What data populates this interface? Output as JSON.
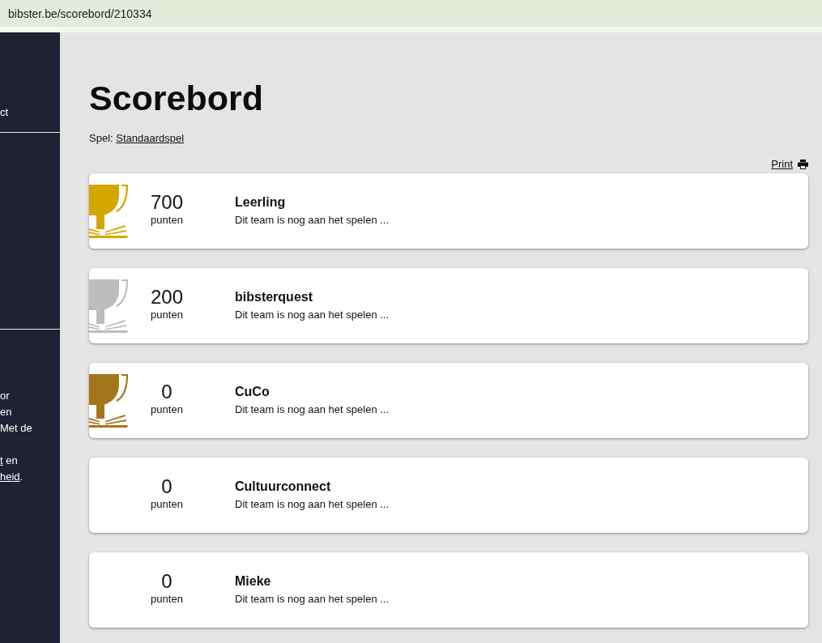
{
  "browser": {
    "url": "bibster.be/scorebord/210334"
  },
  "sidebar": {
    "nav_link": "ct",
    "paragraphs": [
      [
        [
          {
            "text": "or",
            "link": false
          }
        ],
        [
          {
            "text": "en",
            "link": false
          }
        ],
        [
          {
            "text": "Met de",
            "link": false
          }
        ]
      ],
      [
        [
          {
            "text": "t",
            "link": true
          },
          {
            "text": " en",
            "link": false
          }
        ],
        [
          {
            "text": "heid",
            "link": true
          },
          {
            "text": ".",
            "link": false
          }
        ]
      ]
    ]
  },
  "page": {
    "title": "Scorebord",
    "game_label": "Spel:",
    "game_link": "Standaardspel",
    "print_link": "Print"
  },
  "teams": [
    {
      "score": "700",
      "unit": "punten",
      "name": "Leerling",
      "status": "Dit team is nog aan het spelen ...",
      "trophy": true,
      "color": "#d4a600"
    },
    {
      "score": "200",
      "unit": "punten",
      "name": "bibsterquest",
      "status": "Dit team is nog aan het spelen ...",
      "trophy": true,
      "color": "#bdbdbd"
    },
    {
      "score": "0",
      "unit": "punten",
      "name": "CuCo",
      "status": "Dit team is nog aan het spelen ...",
      "trophy": true,
      "color": "#a4761b"
    },
    {
      "score": "0",
      "unit": "punten",
      "name": "Cultuurconnect",
      "status": "Dit team is nog aan het spelen ...",
      "trophy": false
    },
    {
      "score": "0",
      "unit": "punten",
      "name": "Mieke",
      "status": "Dit team is nog aan het spelen ...",
      "trophy": false
    }
  ]
}
